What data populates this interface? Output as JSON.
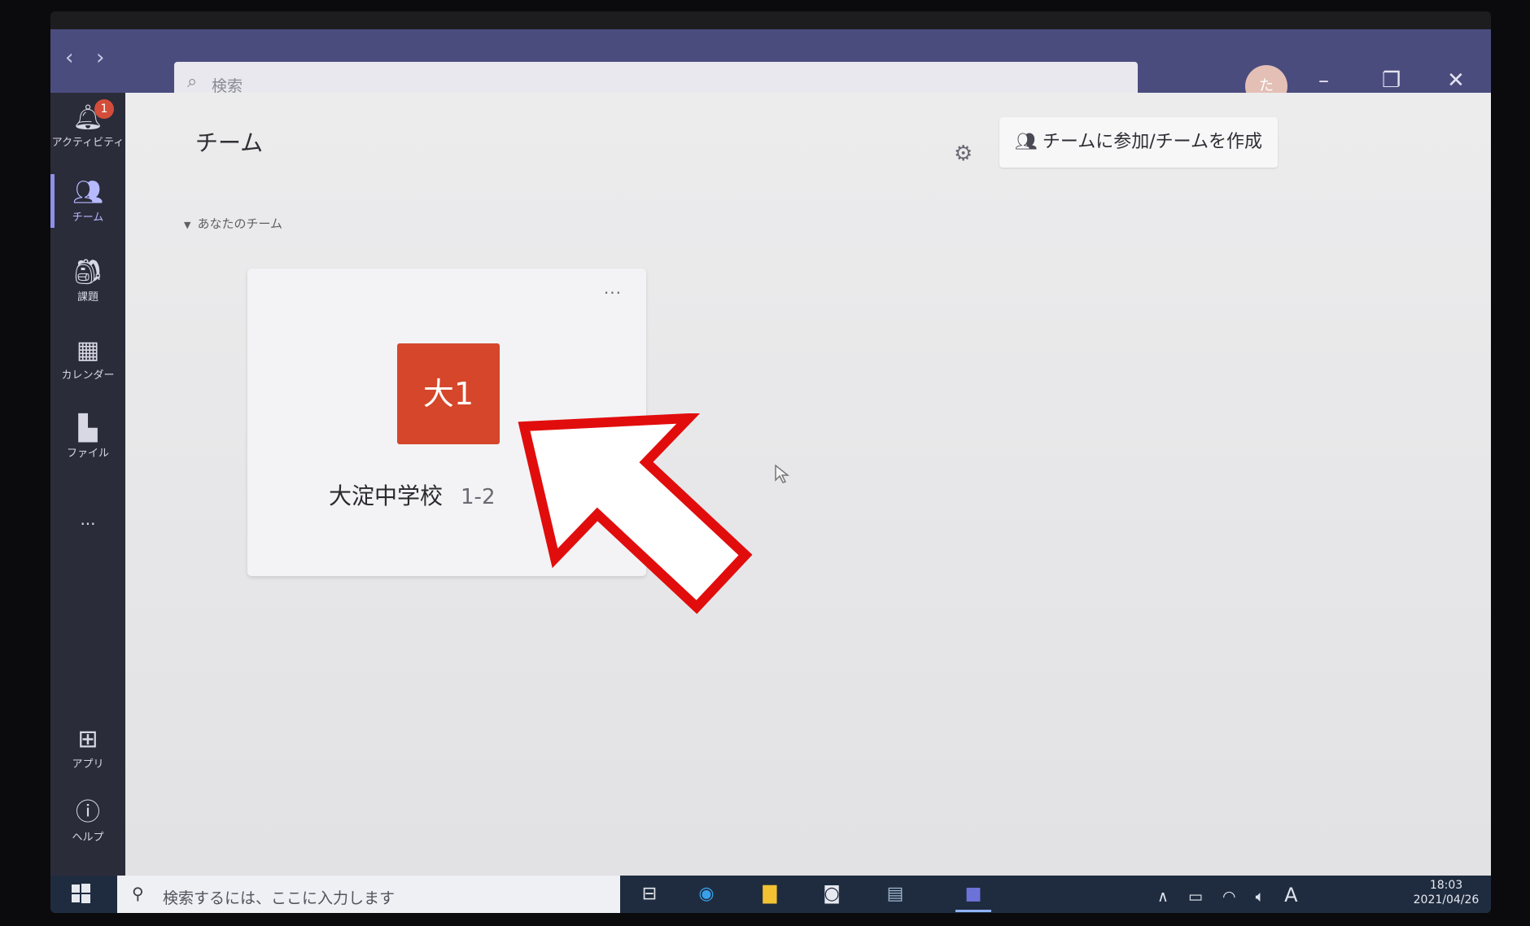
{
  "search": {
    "placeholder": "検索",
    "icon": "search-icon"
  },
  "titlebar": {
    "avatar_initial": "た"
  },
  "rail": {
    "items": [
      {
        "label": "アクティビティ",
        "icon": "bell-icon",
        "badge": "1"
      },
      {
        "label": "チーム",
        "icon": "teams-icon"
      },
      {
        "label": "課題",
        "icon": "backpack-icon"
      },
      {
        "label": "カレンダー",
        "icon": "calendar-icon"
      },
      {
        "label": "ファイル",
        "icon": "file-icon"
      },
      {
        "label": "...",
        "icon": "more-icon"
      },
      {
        "label": "アプリ",
        "icon": "apps-icon"
      },
      {
        "label": "ヘルプ",
        "icon": "help-icon"
      }
    ]
  },
  "main": {
    "title": "チーム",
    "join_button": "チームに参加/チームを作成",
    "section_label": "あなたのチーム",
    "team": {
      "initials": "大1",
      "name": "大淀中学校",
      "class": "1-2",
      "more": "···"
    }
  },
  "taskbar": {
    "search_placeholder": "検索するには、ここに入力します",
    "ime_indicator": "A",
    "time": "18:03",
    "date": "2021/04/26"
  },
  "colors": {
    "titlebar": "#4b4c7e",
    "rail": "#2b2c3a",
    "team_tile": "#d5462a",
    "arrow": "#e10d0d"
  }
}
